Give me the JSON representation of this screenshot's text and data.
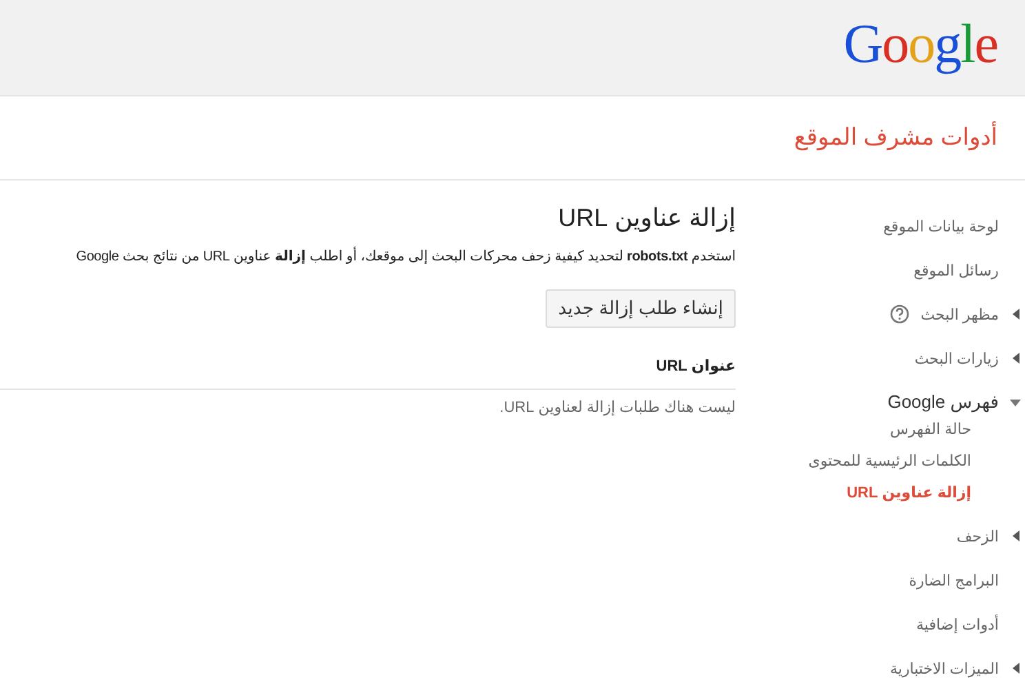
{
  "header": {
    "logo": "Google"
  },
  "product_title": "أدوات مشرف الموقع",
  "sidebar": {
    "items": [
      {
        "kind": "link",
        "label": "لوحة بيانات الموقع",
        "selected": false
      },
      {
        "kind": "link",
        "label": "رسائل الموقع",
        "selected": false
      },
      {
        "kind": "group",
        "label": "مظهر البحث",
        "selected": false,
        "expanded": false,
        "help": true
      },
      {
        "kind": "group",
        "label": "زيارات البحث",
        "selected": false,
        "expanded": false
      },
      {
        "kind": "group",
        "label": "فهرس Google",
        "selected": false,
        "expanded": true,
        "children": [
          {
            "label": "حالة الفهرس",
            "selected": false
          },
          {
            "label": "الكلمات الرئيسية للمحتوى",
            "selected": false
          },
          {
            "label": "إزالة عناوين URL",
            "selected": true
          }
        ]
      },
      {
        "kind": "group",
        "label": "الزحف",
        "selected": false,
        "expanded": false
      },
      {
        "kind": "link",
        "label": "البرامج الضارة",
        "selected": false
      },
      {
        "kind": "link",
        "label": "أدوات إضافية",
        "selected": false
      },
      {
        "kind": "group",
        "label": "الميزات الاختبارية",
        "selected": false,
        "expanded": false
      }
    ]
  },
  "main": {
    "heading": "إزالة عناوين URL",
    "description": "استخدم **robots.txt** لتحديد كيفية زحف محركات البحث إلى موقعك، أو اطلب **إزالة** عناوين URL من نتائج بحث Google",
    "new_request_button": "إنشاء طلب إزالة جديد",
    "table": {
      "columns": [
        "عنوان URL"
      ],
      "empty_message": "ليست هناك طلبات إزالة لعناوين URL."
    }
  }
}
